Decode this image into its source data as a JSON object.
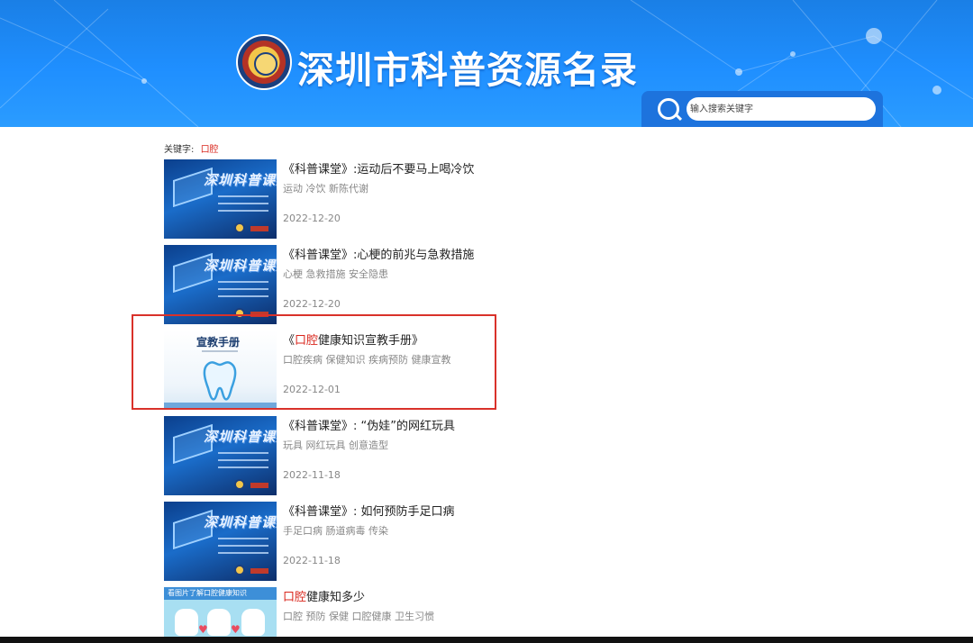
{
  "header": {
    "site_title": "深圳市科普资源名录",
    "search_placeholder": "输入搜索关键字"
  },
  "keyword": {
    "label": "关键字:",
    "value": "口腔"
  },
  "results": [
    {
      "title_prefix": "",
      "title_highlight": "",
      "title_suffix": "《科普课堂》:运动后不要马上喝冷饮",
      "tags": "运动 冷饮 新陈代谢",
      "date": "2022-12-20",
      "thumb_text": "深圳科普课堂"
    },
    {
      "title_prefix": "",
      "title_highlight": "",
      "title_suffix": "《科普课堂》:心梗的前兆与急救措施",
      "tags": "心梗 急救措施 安全隐患",
      "date": "2022-12-20",
      "thumb_text": "深圳科普课堂"
    },
    {
      "title_prefix": "《",
      "title_highlight": "口腔",
      "title_suffix": "健康知识宣教手册》",
      "tags": "口腔疾病 保健知识 疾病预防 健康宣教",
      "date": "2022-12-01",
      "thumb_text": "宣教手册"
    },
    {
      "title_prefix": "",
      "title_highlight": "",
      "title_suffix": "《科普课堂》: “伪娃”的网红玩具",
      "tags": "玩具 网红玩具 创意造型",
      "date": "2022-11-18",
      "thumb_text": "深圳科普课堂"
    },
    {
      "title_prefix": "",
      "title_highlight": "",
      "title_suffix": "《科普课堂》: 如何预防手足口病",
      "tags": "手足口病 肠道病毒 传染",
      "date": "2022-11-18",
      "thumb_text": "深圳科普课堂"
    },
    {
      "title_prefix": "",
      "title_highlight": "口腔",
      "title_suffix": "健康知多少",
      "tags": "口腔 预防 保健 口腔健康 卫生习惯",
      "date": "",
      "thumb_text": "看图片了解口腔健康知识"
    }
  ],
  "colors": {
    "header_blue": "#1f8fff",
    "highlight_red": "#d9261c",
    "annotation_box": "#d9312a"
  }
}
